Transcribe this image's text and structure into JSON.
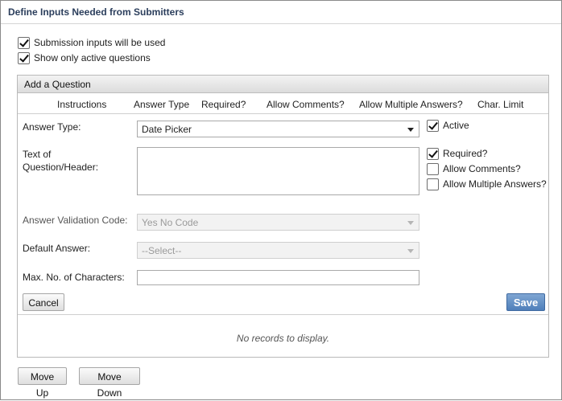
{
  "title": "Define Inputs Needed from Submitters",
  "options": {
    "submission_inputs": {
      "label": "Submission inputs will be used",
      "checked": true
    },
    "show_active": {
      "label": "Show only active questions",
      "checked": true
    }
  },
  "panel": {
    "header": "Add a Question",
    "columns": [
      "Instructions",
      "Answer Type",
      "Required?",
      "Allow Comments?",
      "Allow Multiple Answers?",
      "Char. Limit"
    ],
    "answer_type": {
      "label": "Answer Type:",
      "value": "Date Picker"
    },
    "active": {
      "label": "Active",
      "checked": true
    },
    "text_question": {
      "label_line1": "Text of",
      "label_line2": "Question/Header:",
      "value": ""
    },
    "required": {
      "label": "Required?",
      "checked": true
    },
    "allow_comments": {
      "label": "Allow Comments?",
      "checked": false
    },
    "allow_multiple": {
      "label": "Allow Multiple Answers?",
      "checked": false
    },
    "validation_code": {
      "label": "Answer Validation Code:",
      "value": "Yes No Code"
    },
    "default_answer": {
      "label": "Default Answer:",
      "value": "--Select--"
    },
    "max_chars": {
      "label": "Max. No. of Characters:",
      "value": ""
    },
    "cancel_label": "Cancel",
    "save_label": "Save",
    "empty_message": "No records to display."
  },
  "footer": {
    "move_up": "Move Up",
    "move_down": "Move Down"
  },
  "colors": {
    "title": "#2b3e5c",
    "save_button": "#5b87c0"
  }
}
